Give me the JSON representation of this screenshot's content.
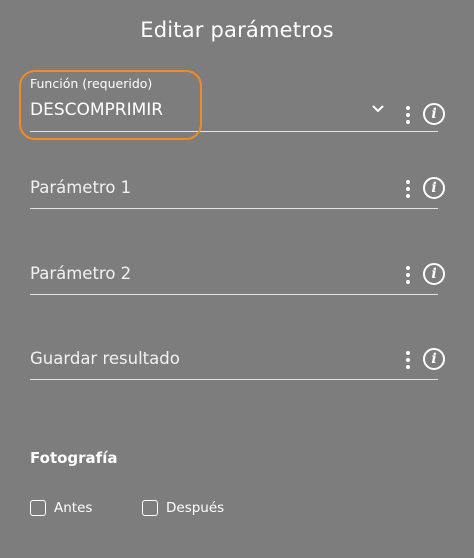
{
  "dialog": {
    "title": "Editar parámetros"
  },
  "fields": {
    "funcion": {
      "label": "Función (requerido)",
      "value": "DESCOMPRIMIR"
    },
    "parametro1": {
      "placeholder": "Parámetro 1"
    },
    "parametro2": {
      "placeholder": "Parámetro 2"
    },
    "guardar": {
      "placeholder": "Guardar resultado"
    }
  },
  "photo_section": {
    "title": "Fotografía",
    "options": [
      {
        "label": "Antes",
        "checked": false
      },
      {
        "label": "Después",
        "checked": false
      }
    ]
  },
  "icons": {
    "info": "info-icon",
    "more": "more-vertical-icon",
    "dropdown": "chevron-down-icon"
  },
  "colors": {
    "background": "#7d7d7d",
    "highlight": "#f08a2a",
    "text": "#ffffff"
  }
}
